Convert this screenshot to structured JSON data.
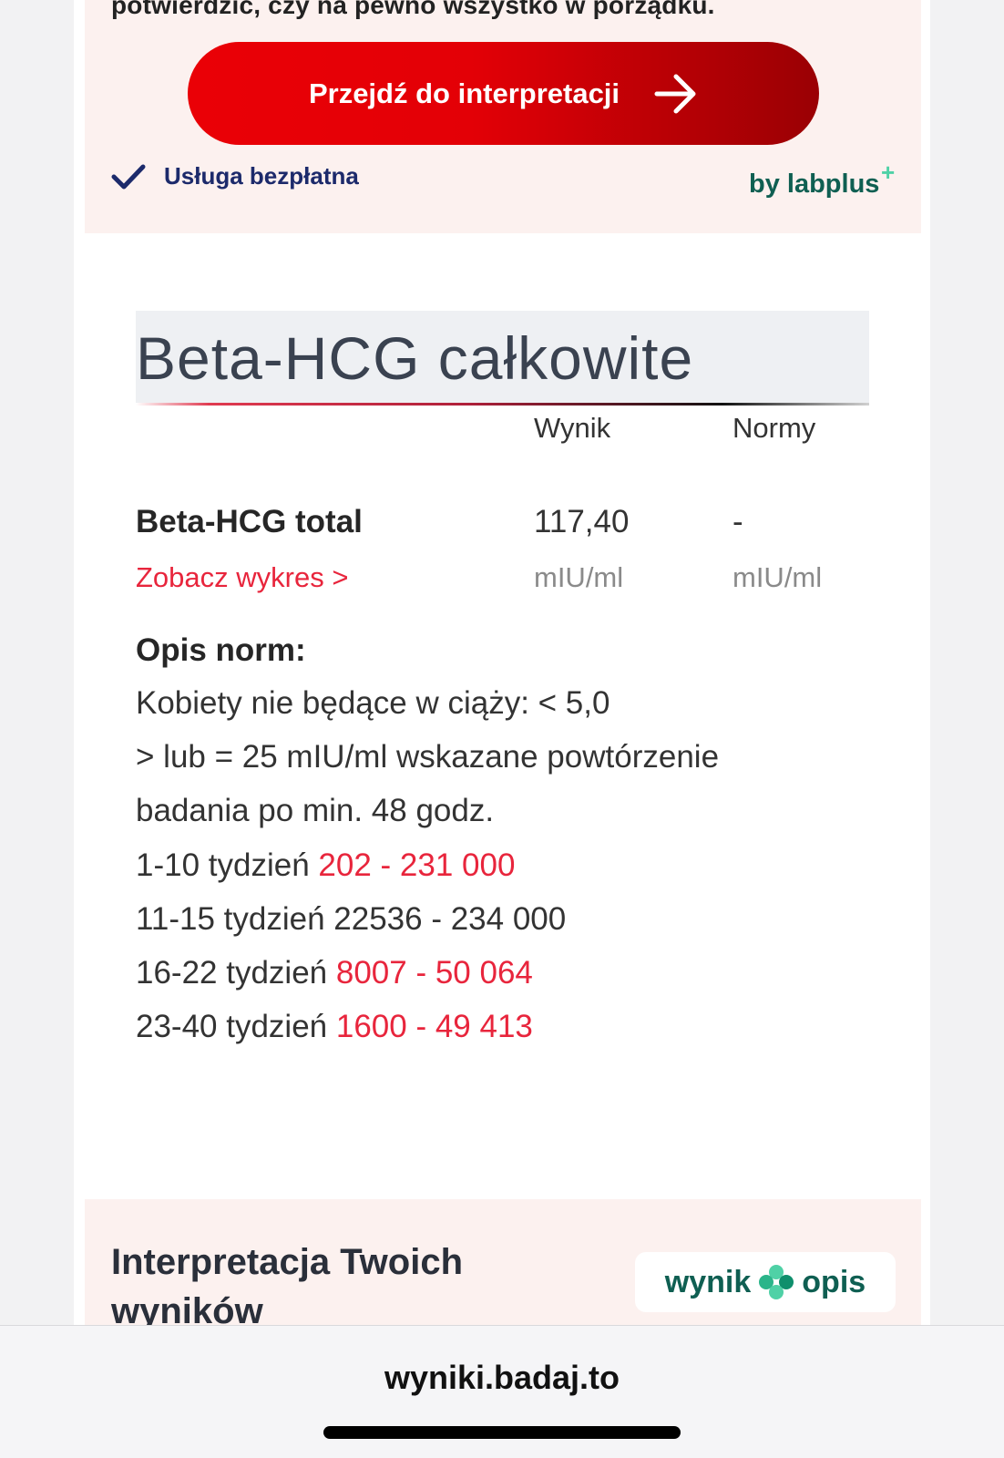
{
  "promo": {
    "text": "potwierdzić, czy na pewno wszystko w porządku.",
    "cta_label": "Przejdź do interpretacji",
    "free_label": "Usługa bezpłatna",
    "brand": "by labplus",
    "brand_plus": "+"
  },
  "result": {
    "title": "Beta-HCG całkowite",
    "col_result": "Wynik",
    "col_norms": "Normy",
    "test_name": "Beta-HCG total",
    "value": "117,40",
    "norm": "-",
    "chart_link": "Zobacz wykres >",
    "unit_value": "mIU/ml",
    "unit_norm": "mIU/ml"
  },
  "description": {
    "title": "Opis norm:",
    "line1": "Kobiety nie będące w ciąży: < 5,0",
    "line2": "> lub = 25 mIU/ml wskazane powtórzenie",
    "line3": "badania po min. 48 godz.",
    "line4_label": "1-10 tydzień ",
    "line4_range": "202 - 231 000",
    "line5": "11-15 tydzień 22536 - 234 000",
    "line6_label": "16-22 tydzień ",
    "line6_range": "8007 - 50 064",
    "line7_label": "23-40 tydzień ",
    "line7_range": "1600 - 49 413"
  },
  "interpretation": {
    "title": "Interpretacja Twoich wyników",
    "badge_left": "wynik",
    "badge_right": "opis"
  },
  "browser": {
    "url": "wyniki.badaj.to"
  },
  "colors": {
    "accent_red": "#e8253c",
    "brand_green": "#0f5f52",
    "navy": "#1c2a6b"
  }
}
